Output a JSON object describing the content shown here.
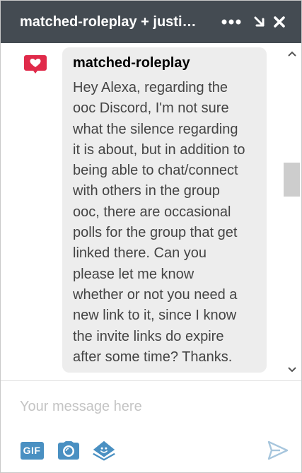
{
  "header": {
    "title": "matched-roleplay + justi…"
  },
  "message": {
    "sender": "matched-roleplay",
    "avatar_icon": "heart-icon",
    "text_lines": [
      "Hey Alexa, regarding the",
      "ooc Discord, I'm not sure",
      "what the silence regarding",
      "it is about, but in addition to",
      "being able to chat/connect",
      "with others in the group",
      "ooc, there are occasional",
      "polls for the group that get",
      "linked there. Can you",
      "please let me know",
      "whether or not you need a",
      "new link to it, since I know",
      "the invite links do expire",
      "after some time? Thanks."
    ]
  },
  "composer": {
    "placeholder": "Your message here",
    "value": "",
    "gif_label": "GIF"
  },
  "colors": {
    "header_bg": "#444b52",
    "bubble_bg": "#ededed",
    "accent": "#4a90c2",
    "avatar_red": "#e02a4a",
    "send_icon": "#a7c6dd"
  }
}
